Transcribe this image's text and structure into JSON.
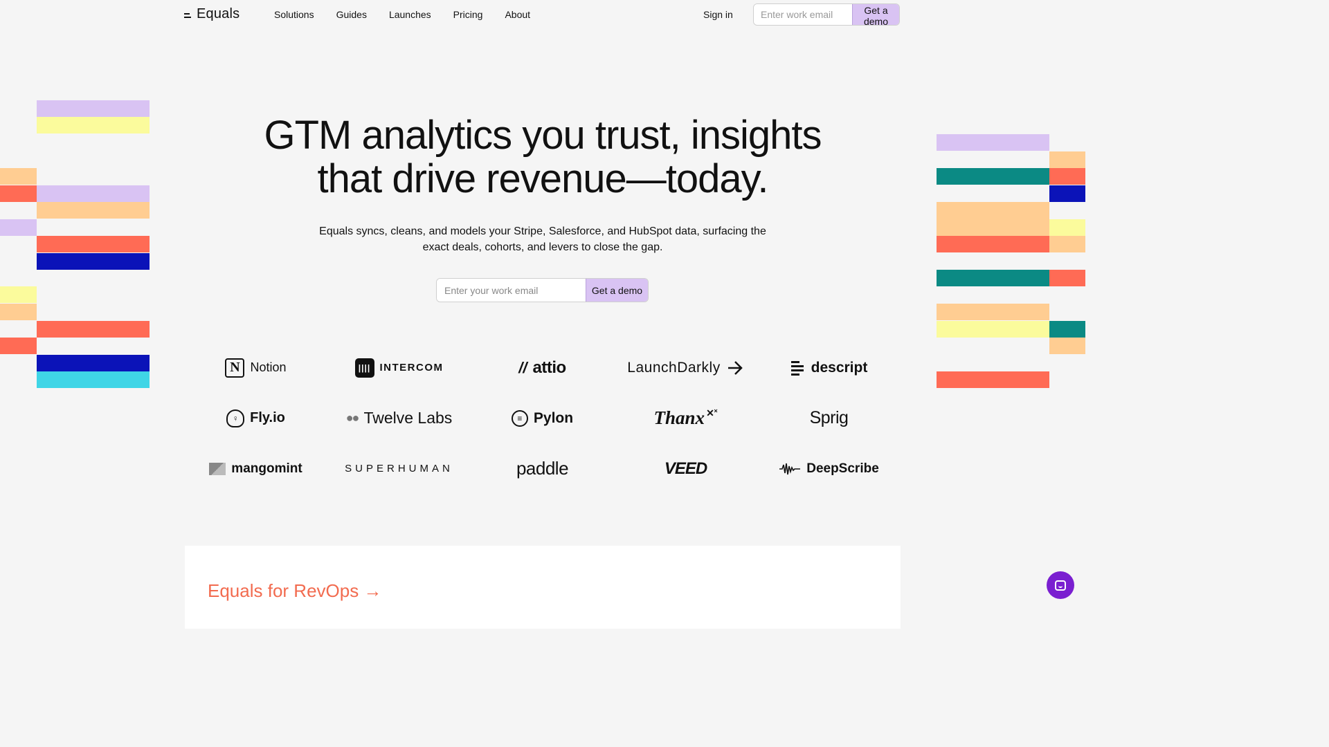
{
  "nav": {
    "brand": "Equals",
    "links": [
      "Solutions",
      "Guides",
      "Launches",
      "Pricing",
      "About"
    ],
    "signin": "Sign in",
    "email_placeholder": "Enter work email",
    "cta": "Get a demo"
  },
  "hero": {
    "title_line1": "GTM analytics you trust, insights",
    "title_line2": "that drive revenue—today.",
    "subtitle_line1": "Equals syncs, cleans, and models your Stripe, Salesforce, and HubSpot data, surfacing the",
    "subtitle_line2": "exact deals, cohorts, and levers to close the gap.",
    "email_placeholder": "Enter your work email",
    "cta": "Get a demo"
  },
  "customers": [
    {
      "name": "Notion",
      "icon": "notion-icon"
    },
    {
      "name": "INTERCOM",
      "icon": "intercom-icon"
    },
    {
      "name": "attio",
      "icon": "attio-icon"
    },
    {
      "name": "LaunchDarkly",
      "icon": "arrow-icon"
    },
    {
      "name": "descript",
      "icon": "descript-icon"
    },
    {
      "name": "Fly.io",
      "icon": "balloon-icon"
    },
    {
      "name": "Twelve Labs",
      "icon": "twelve-labs-icon"
    },
    {
      "name": "Pylon",
      "icon": "pylon-icon"
    },
    {
      "name": "Thanx",
      "icon": "sparkle-icon"
    },
    {
      "name": "Sprig",
      "icon": ""
    },
    {
      "name": "mangomint",
      "icon": "mangomint-icon"
    },
    {
      "name": "SUPERHUMAN",
      "icon": ""
    },
    {
      "name": "paddle",
      "icon": ""
    },
    {
      "name": "VEED",
      "icon": ""
    },
    {
      "name": "DeepScribe",
      "icon": "waveform-icon"
    }
  ],
  "section": {
    "title": "Equals for RevOps →"
  },
  "colors": {
    "lavender": "#d9c3f3",
    "yellow": "#fbfb9c",
    "peach": "#ffcd92",
    "coral": "#ff6b55",
    "navy": "#0b13b8",
    "cyan": "#3fd5e6",
    "teal": "#0b8a84",
    "accent_text": "#f26b4f",
    "chat": "#7a1fd0"
  }
}
